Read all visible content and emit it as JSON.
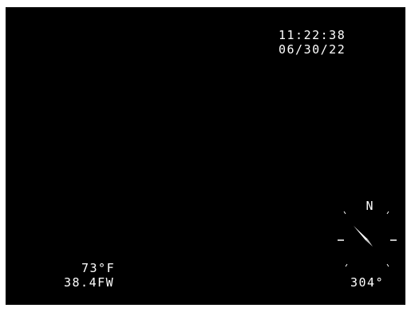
{
  "overlay": {
    "time": "11:22:38",
    "date": "06/30/22",
    "temperature": "73°F",
    "depth": "38.4FW",
    "heading": "304°"
  },
  "compass": {
    "north_label": "N",
    "heading_degrees": 304,
    "needle_icon": "compass-needle-icon"
  },
  "colors": {
    "background": "#000000",
    "text": "#ffffff",
    "frame_border": "#ffffff"
  }
}
